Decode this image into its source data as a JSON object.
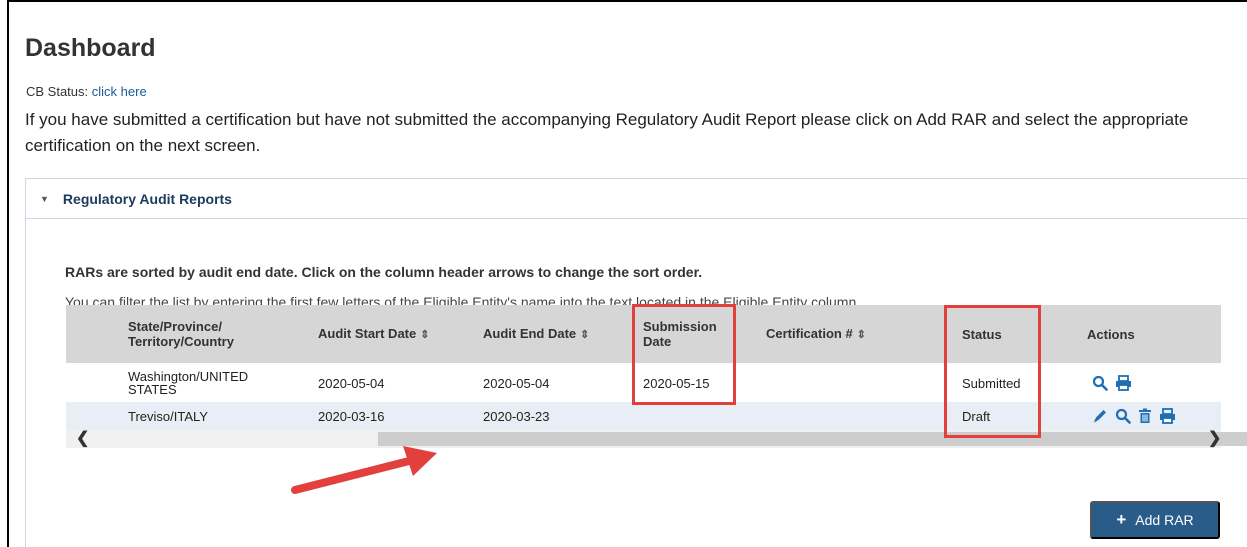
{
  "page": {
    "title": "Dashboard",
    "cb_status_label": "CB Status:",
    "cb_status_link": "click here",
    "intro": "If you have submitted a certification but have not submitted the accompanying Regulatory Audit Report please click on Add RAR and select the appropriate certification on the next screen."
  },
  "panel": {
    "title": "Regulatory Audit Reports",
    "sort_note": "RARs are sorted by audit end date. Click on the column header arrows to change the sort order.",
    "filter_note": "You can filter the list by entering the first few letters of the Eligible Entity's name into the text located in the Eligible Entity column."
  },
  "table": {
    "headers": {
      "location_line1": "State/Province/",
      "location_line2": "Territory/Country",
      "audit_start": "Audit Start Date",
      "audit_end": "Audit End Date",
      "submission_line1": "Submission",
      "submission_line2": "Date",
      "certification": "Certification #",
      "status": "Status",
      "actions": "Actions"
    },
    "rows": [
      {
        "location_line1": "Washington/UNITED",
        "location_line2": "STATES",
        "audit_start": "2020-05-04",
        "audit_end": "2020-05-04",
        "submission": "2020-05-15",
        "certification": "",
        "status": "Submitted",
        "actions": [
          "view-icon",
          "print-icon"
        ]
      },
      {
        "location_line1": "Treviso/ITALY",
        "location_line2": "",
        "audit_start": "2020-03-16",
        "audit_end": "2020-03-23",
        "submission": "",
        "certification": "",
        "status": "Draft",
        "actions": [
          "edit-icon",
          "view-icon",
          "delete-icon",
          "print-icon"
        ]
      }
    ]
  },
  "buttons": {
    "add_rar": "Add RAR"
  },
  "colors": {
    "link": "#1a5a96",
    "header_bg": "#d6d6d6",
    "alt_row_bg": "#e8eef5",
    "button_bg": "#2a5c8a",
    "annotation_red": "#e2403d",
    "icon_blue": "#1e6fb4"
  }
}
